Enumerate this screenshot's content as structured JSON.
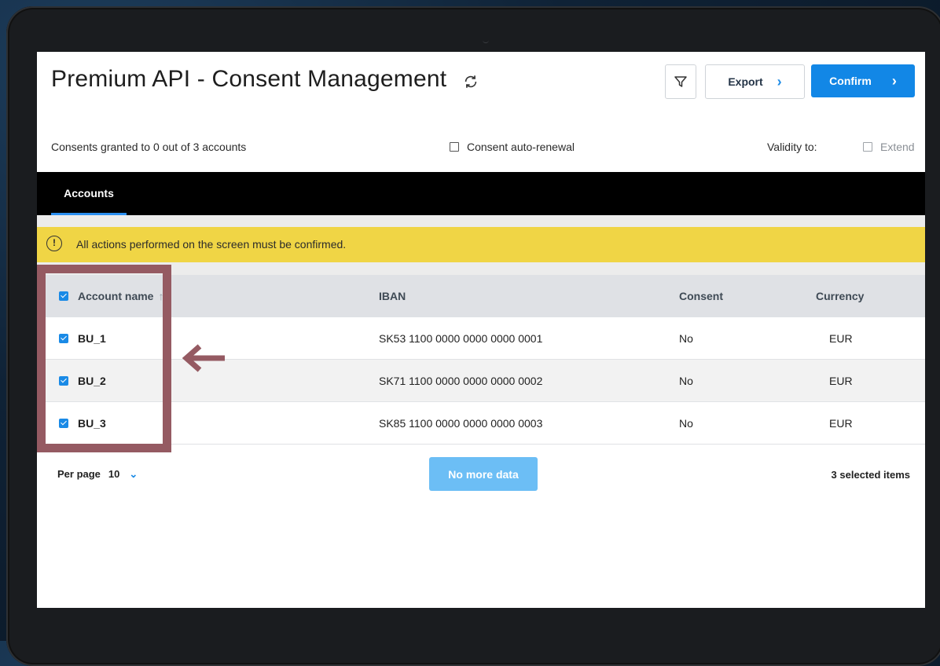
{
  "app": {
    "title": "Premium API - Consent Management"
  },
  "toolbar": {
    "export_label": "Export",
    "confirm_label": "Confirm",
    "chevron": "›"
  },
  "info": {
    "consents_granted": "Consents granted to 0 out of 3 accounts",
    "auto_renewal_label": "Consent auto-renewal",
    "validity_label": "Validity to:",
    "extend_label": "Extend"
  },
  "tabs": [
    {
      "label": "Accounts",
      "active": true
    }
  ],
  "notice": {
    "icon": "!",
    "text": "All actions performed on the screen must be confirmed."
  },
  "table": {
    "columns": [
      "Account name",
      "IBAN",
      "Consent",
      "Currency"
    ],
    "sort_indicator": "↑",
    "rows": [
      {
        "name": "BU_1",
        "iban": "SK53 1100 0000 0000 0000 0001",
        "consent": "No",
        "currency": "EUR",
        "checked": true
      },
      {
        "name": "BU_2",
        "iban": "SK71 1100 0000 0000 0000 0002",
        "consent": "No",
        "currency": "EUR",
        "checked": true
      },
      {
        "name": "BU_3",
        "iban": "SK85 1100 0000 0000 0000 0003",
        "consent": "No",
        "currency": "EUR",
        "checked": true
      }
    ]
  },
  "footer": {
    "per_page_label": "Per page",
    "per_page_value": "10",
    "no_more_label": "No more data",
    "selected_text": "3 selected items"
  },
  "colors": {
    "accent": "#1287e6",
    "notice_bg": "#f0d545",
    "annotation": "#955a62",
    "tab_bar": "#000000"
  },
  "icons": [
    "refresh-icon",
    "filter-icon",
    "chevron-right-icon",
    "alert-icon",
    "checkbox-icon",
    "chevron-down-icon",
    "arrow-left-icon"
  ]
}
